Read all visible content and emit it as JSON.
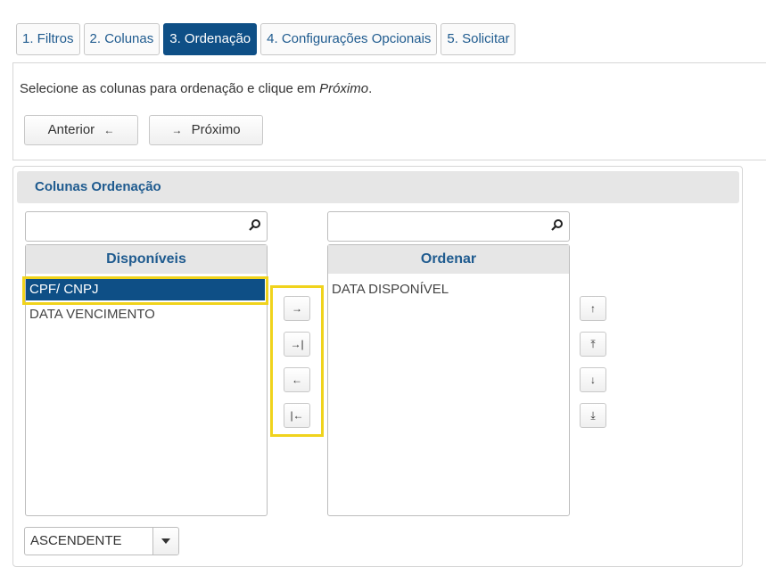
{
  "tabs": [
    {
      "label": "1. Filtros",
      "active": false
    },
    {
      "label": "2. Colunas",
      "active": false
    },
    {
      "label": "3. Ordenação",
      "active": true
    },
    {
      "label": "4. Configurações Opcionais",
      "active": false
    },
    {
      "label": "5. Solicitar",
      "active": false
    }
  ],
  "instruction": {
    "text": "Selecione as colunas para ordenação e clique em ",
    "emphasis": "Próximo",
    "suffix": "."
  },
  "nav": {
    "prev_label": "Anterior",
    "prev_arrow": "←",
    "next_arrow": "→",
    "next_label": "Próximo"
  },
  "panel": {
    "title": "Colunas Ordenação"
  },
  "available": {
    "search_value": "",
    "header": "Disponíveis",
    "items": [
      "CPF/ CNPJ",
      "DATA VENCIMENTO"
    ],
    "selected_index": 0
  },
  "ordered": {
    "search_value": "",
    "header": "Ordenar",
    "items": [
      "DATA DISPONÍVEL"
    ]
  },
  "transfer_buttons": {
    "move_right": "→",
    "move_all_right": "→|",
    "move_left": "←",
    "move_all_left": "|←"
  },
  "order_buttons": {
    "up": "↑",
    "top": "⤒",
    "down": "↓",
    "bottom": "⤓"
  },
  "sort_direction": {
    "value": "ASCENDENTE"
  },
  "colors": {
    "accent": "#0e4f86",
    "highlight": "#f0d31c",
    "link": "#1f5b8f"
  }
}
